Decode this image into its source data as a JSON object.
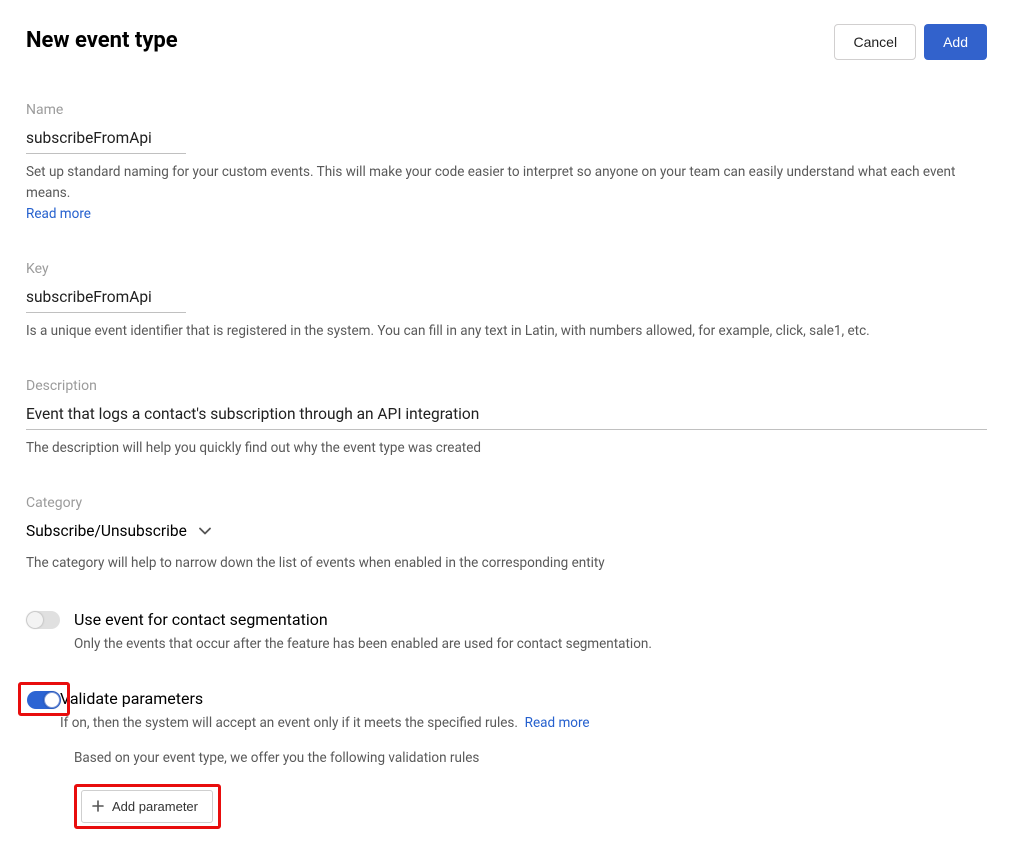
{
  "header": {
    "title": "New event type",
    "cancel_label": "Cancel",
    "add_label": "Add"
  },
  "name_field": {
    "label": "Name",
    "value": "subscribeFromApi",
    "help": "Set up standard naming for your custom events. This will make your code easier to interpret so anyone on your team can easily understand what each event means.",
    "read_more": "Read more"
  },
  "key_field": {
    "label": "Key",
    "value": "subscribeFromApi",
    "help": "Is a unique event identifier that is registered in the system. You can fill in any text in Latin, with numbers allowed, for example, click, sale1, etc."
  },
  "description_field": {
    "label": "Description",
    "value": "Event that logs a contact's subscription through an API integration",
    "help": "The description will help you quickly find out why the event type was created"
  },
  "category_field": {
    "label": "Category",
    "value": "Subscribe/Unsubscribe",
    "help": "The category will help to narrow down the list of events when enabled in the corresponding entity"
  },
  "segmentation_toggle": {
    "title": "Use event for contact segmentation",
    "help": "Only the events that occur after the feature has been enabled are used for contact segmentation."
  },
  "validate_toggle": {
    "title": "Validate parameters",
    "help": "If on, then the system will accept an event only if it meets the specified rules.",
    "read_more": "Read more",
    "rules_intro": "Based on your event type, we offer you the following validation rules",
    "add_param_label": "Add parameter"
  }
}
